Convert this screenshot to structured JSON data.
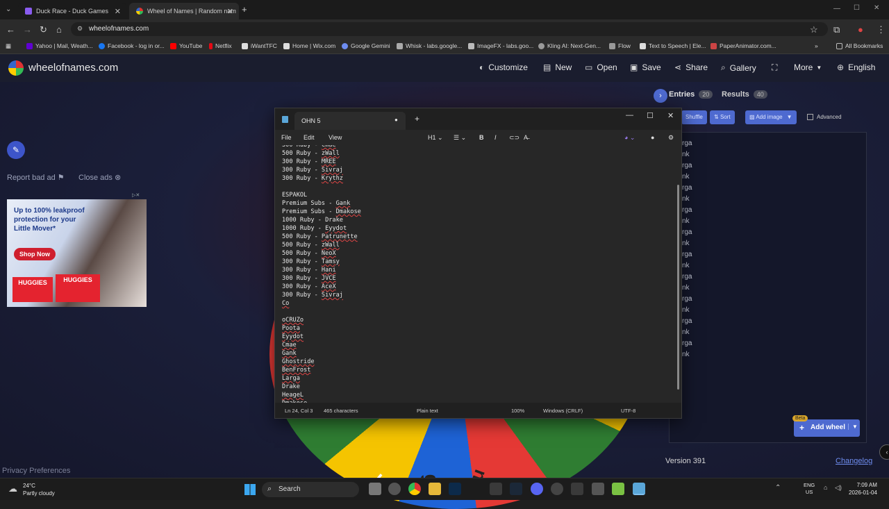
{
  "browser": {
    "tabs": [
      {
        "label": "Duck Race - Duck Games",
        "active": false
      },
      {
        "label": "Wheel of Names | Random nam",
        "active": true
      }
    ],
    "url": "wheelofnames.com",
    "bookmarks": [
      "Yahoo | Mail, Weath...",
      "Facebook - log in or...",
      "YouTube",
      "Netflix",
      "iWantTFC",
      "Home | Wix.com",
      "Google Gemini",
      "Whisk - labs.google...",
      "ImageFX - labs.goo...",
      "Kling AI: Next-Gen...",
      "Flow",
      "Text to Speech | Ele...",
      "PaperAnimator.com..."
    ],
    "all_bookmarks": "All Bookmarks"
  },
  "site": {
    "brand": "wheelofnames.com",
    "nav": {
      "customize": "Customize",
      "new": "New",
      "open": "Open",
      "save": "Save",
      "share": "Share",
      "gallery": "Gallery",
      "more": "More",
      "language": "English"
    },
    "report_bad_ad": "Report bad ad",
    "close_ads": "Close ads",
    "ad": {
      "headline": "Up to 100% leakproof protection for your Little Mover*",
      "cta": "Shop Now",
      "brand": "HUGGIES"
    },
    "privacy": "Privacy Preferences",
    "wheel_labels": [
      "k",
      "ga",
      "nk"
    ],
    "panel": {
      "entries_label": "Entries",
      "entries_count": "20",
      "results_label": "Results",
      "results_count": "40",
      "shuffle": "Shuffle",
      "sort": "Sort",
      "add_image": "Add image",
      "advanced": "Advanced",
      "entries": [
        "rga",
        "nk",
        "rga",
        "nk",
        "rga",
        "nk",
        "rga",
        "nk",
        "rga",
        "nk",
        "rga",
        "nk",
        "rga",
        "nk",
        "rga",
        "nk",
        "rga",
        "nk",
        "rga",
        "nk"
      ],
      "beta": "Beta",
      "add_wheel": "Add wheel",
      "version": "Version 391",
      "changelog": "Changelog"
    }
  },
  "notepad": {
    "tab_title": "OHN 5",
    "menu": [
      "File",
      "Edit",
      "View"
    ],
    "toolbar": {
      "heading": "H1"
    },
    "lines": [
      {
        "a": "300 Ruby - ",
        "b": "Cmae"
      },
      {
        "a": "500 Ruby - ",
        "b": "zWall"
      },
      {
        "a": "300 Ruby - ",
        "b": "MREE"
      },
      {
        "a": "300 Ruby - ",
        "b": "Sivraj"
      },
      {
        "a": "300 Ruby - ",
        "b": "Krythz"
      },
      {
        "a": "",
        "b": ""
      },
      {
        "a": "ESPAKOL",
        "b": ""
      },
      {
        "a": "Premium Subs - ",
        "b": "Gank"
      },
      {
        "a": "Premium Subs - ",
        "b": "Dmakose"
      },
      {
        "a": "1000 Ruby - Drake",
        "b": ""
      },
      {
        "a": "1000 Ruby - ",
        "b": "Eyydot"
      },
      {
        "a": "500 Ruby - ",
        "b": "Patrunette"
      },
      {
        "a": "500 Ruby - ",
        "b": "zWall"
      },
      {
        "a": "500 Ruby - ",
        "b": "NeoX"
      },
      {
        "a": "300 Ruby - ",
        "b": "Tamsy"
      },
      {
        "a": "300 Ruby - ",
        "b": "Hani"
      },
      {
        "a": "300 Ruby - ",
        "b": "JVCE"
      },
      {
        "a": "300 Ruby - ",
        "b": "AceX"
      },
      {
        "a": "300 Ruby - ",
        "b": "Sivraj"
      },
      {
        "a": "",
        "b": "Co"
      },
      {
        "a": "",
        "b": ""
      },
      {
        "a": "",
        "b": "oCRUZo"
      },
      {
        "a": "",
        "b": "Poota"
      },
      {
        "a": "",
        "b": "Eyydot"
      },
      {
        "a": "",
        "b": "Cmae"
      },
      {
        "a": "",
        "b": "Gank"
      },
      {
        "a": "",
        "b": "Ghostride"
      },
      {
        "a": "",
        "b": "BenFrost"
      },
      {
        "a": "",
        "b": "Larga"
      },
      {
        "a": "Drake",
        "b": ""
      },
      {
        "a": "",
        "b": "HeageL"
      },
      {
        "a": "",
        "b": "Dmakose"
      }
    ],
    "status": {
      "position": "Ln 24, Col 3",
      "chars": "465 characters",
      "format": "Plain text",
      "zoom": "100%",
      "eol": "Windows (CRLF)",
      "encoding": "UTF-8"
    }
  },
  "taskbar": {
    "weather_temp": "24°C",
    "weather_desc": "Partly cloudy",
    "search": "Search",
    "lang_top": "ENG",
    "lang_bottom": "US",
    "time": "7:09 AM",
    "date": "2026-01-04"
  }
}
